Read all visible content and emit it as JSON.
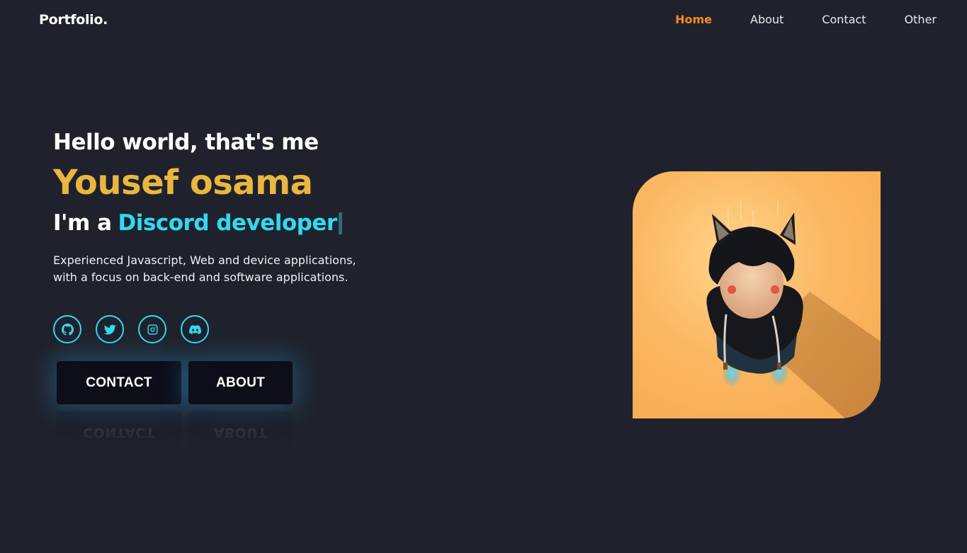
{
  "header": {
    "logo": "Portfolio.",
    "nav": [
      {
        "label": "Home",
        "active": true
      },
      {
        "label": "About",
        "active": false
      },
      {
        "label": "Contact",
        "active": false
      },
      {
        "label": "Other",
        "active": false
      }
    ]
  },
  "hero": {
    "greeting": "Hello world, that's me",
    "name": "Yousef osama",
    "role_prefix": "I'm a",
    "role_typed": "Discord developer",
    "description_line1": "Experienced Javascript, Web and device applications,",
    "description_line2": "with a focus on back-end and software applications.",
    "socials": [
      {
        "icon": "github-icon"
      },
      {
        "icon": "twitter-icon"
      },
      {
        "icon": "instagram-icon"
      },
      {
        "icon": "discord-icon"
      }
    ],
    "buttons": {
      "contact_label": "CONTACT",
      "about_label": "ABOUT"
    }
  },
  "colors": {
    "background": "#1f222c",
    "accent_orange": "#ff8a1f",
    "name_gold": "#e9b740",
    "accent_cyan": "#33d9f2",
    "button_bg": "#0d0e1a"
  }
}
